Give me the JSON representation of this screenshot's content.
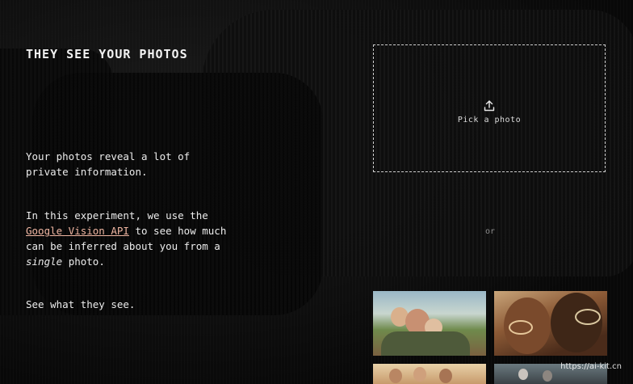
{
  "header": {
    "title": "THEY SEE YOUR PHOTOS"
  },
  "intro": {
    "p1": "Your photos reveal a lot of private information.",
    "p2_before": "In this experiment, we use the",
    "p2_link": "Google Vision API",
    "p2_middle": "to see how much can be inferred about you from a",
    "p2_em": "single",
    "p2_after": "photo.",
    "p3": "See what they see."
  },
  "upload": {
    "label": "Pick a photo",
    "icon": "upload-icon"
  },
  "divider": {
    "or_label": "or"
  },
  "samples": [
    {
      "name": "family-photo-outdoor"
    },
    {
      "name": "couple-portrait-glasses"
    },
    {
      "name": "group-photo-field"
    },
    {
      "name": "crowd-photo-street"
    }
  ],
  "watermark": "https://ai-kit.cn",
  "colors": {
    "background": "#0a0a0a",
    "text": "#e8e8e8",
    "link": "#f0b6a2"
  }
}
